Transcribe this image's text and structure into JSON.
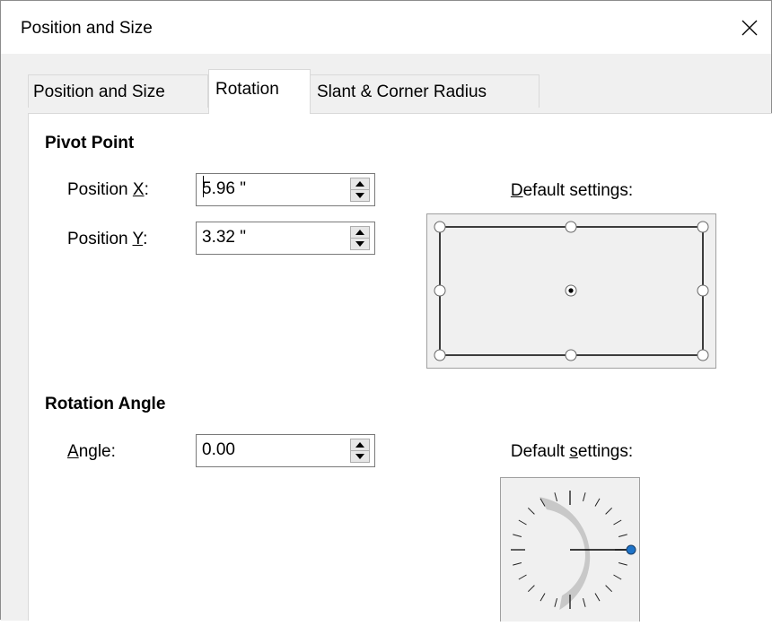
{
  "window": {
    "title": "Position and Size",
    "close_icon": "close-icon"
  },
  "tabs": [
    {
      "label": "Position and Size",
      "active": false
    },
    {
      "label": "Rotation",
      "active": true
    },
    {
      "label": "Slant & Corner Radius",
      "active": false
    }
  ],
  "pivot": {
    "section_title": "Pivot Point",
    "pos_x_label_pre": "Position ",
    "pos_x_label_key": "X",
    "pos_x_label_post": ":",
    "pos_x_value": "5.96 \"",
    "pos_y_label_pre": "Position ",
    "pos_y_label_key": "Y",
    "pos_y_label_post": ":",
    "pos_y_value": "3.32 \"",
    "default_label_key": "D",
    "default_label_rest": "efault settings:",
    "selected_point": "center"
  },
  "rotation": {
    "section_title": "Rotation Angle",
    "angle_label_key": "A",
    "angle_label_rest": "ngle:",
    "angle_value": "0.00",
    "default_label_pre": "Default ",
    "default_label_key": "s",
    "default_label_rest": "ettings:",
    "dial_angle_degrees": 0
  },
  "colors": {
    "dial_handle": "#1e73c8",
    "panel_bg": "#ffffff",
    "dialog_bg": "#f0f0f0"
  }
}
